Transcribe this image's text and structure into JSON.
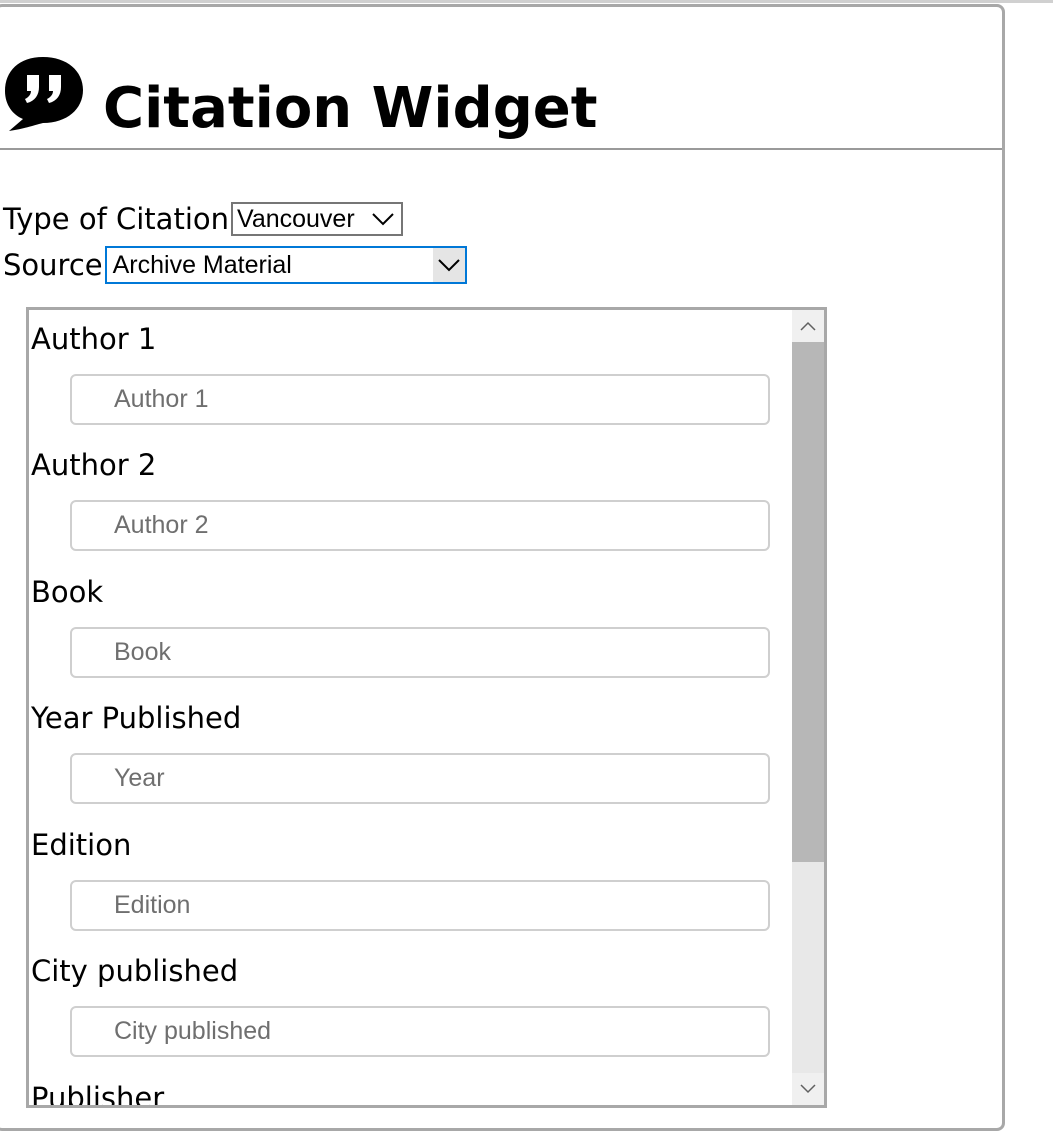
{
  "header": {
    "title": "Citation Widget",
    "icon": "speech-bubble-quote-icon"
  },
  "controls": {
    "type_label": "Type of Citation",
    "type_value": "Vancouver",
    "source_label": "Source",
    "source_value": "Archive Material"
  },
  "fields": [
    {
      "label": "Author 1",
      "placeholder": "Author 1"
    },
    {
      "label": "Author 2",
      "placeholder": "Author 2"
    },
    {
      "label": "Book",
      "placeholder": "Book"
    },
    {
      "label": "Year Published",
      "placeholder": "Year"
    },
    {
      "label": "Edition",
      "placeholder": "Edition"
    },
    {
      "label": "City published",
      "placeholder": "City published"
    },
    {
      "label": "Publisher",
      "placeholder": ""
    }
  ],
  "colors": {
    "border": "#a8a8a8",
    "focus": "#0078d7",
    "scroll_thumb": "#b7b7b7",
    "scroll_track": "#e8e8e8"
  }
}
